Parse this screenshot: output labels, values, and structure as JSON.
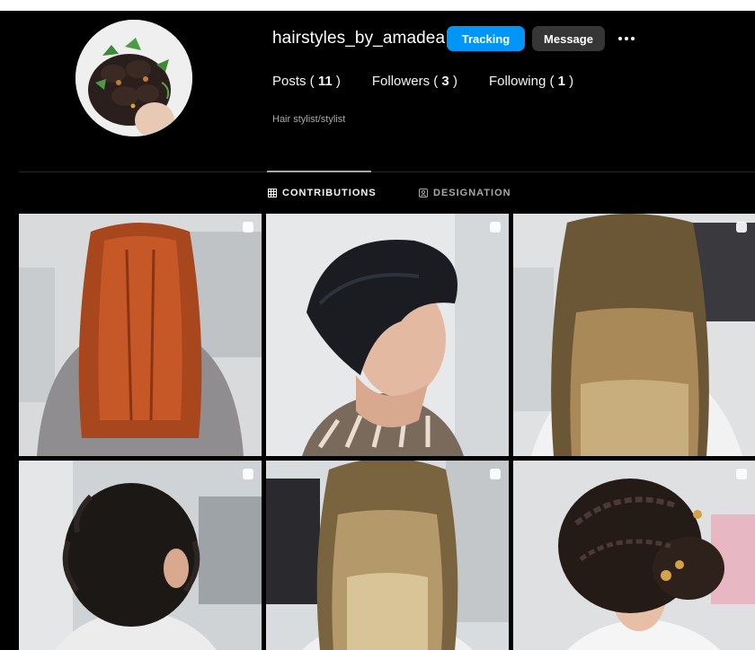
{
  "profile": {
    "username": "hairstyles_by_amadea",
    "follow_label": "Tracking",
    "message_label": "Message",
    "bio": "Hair stylist/stylist"
  },
  "stats": {
    "posts_label": "Posts (",
    "posts_count": "11",
    "followers_label": "Followers (",
    "followers_count": "3",
    "following_label": "Following (",
    "following_count": "1",
    "close": ")"
  },
  "tabs": {
    "posts_label": "CONTRIBUTIONS",
    "tagged_label": "DESIGNATION"
  },
  "colors": {
    "accent": "#0095f6",
    "secondary_button": "#363636"
  },
  "icons": {
    "more": "more-options-icon",
    "grid": "grid-icon",
    "tagged": "tagged-icon",
    "multi": "multiple-photos-icon"
  }
}
